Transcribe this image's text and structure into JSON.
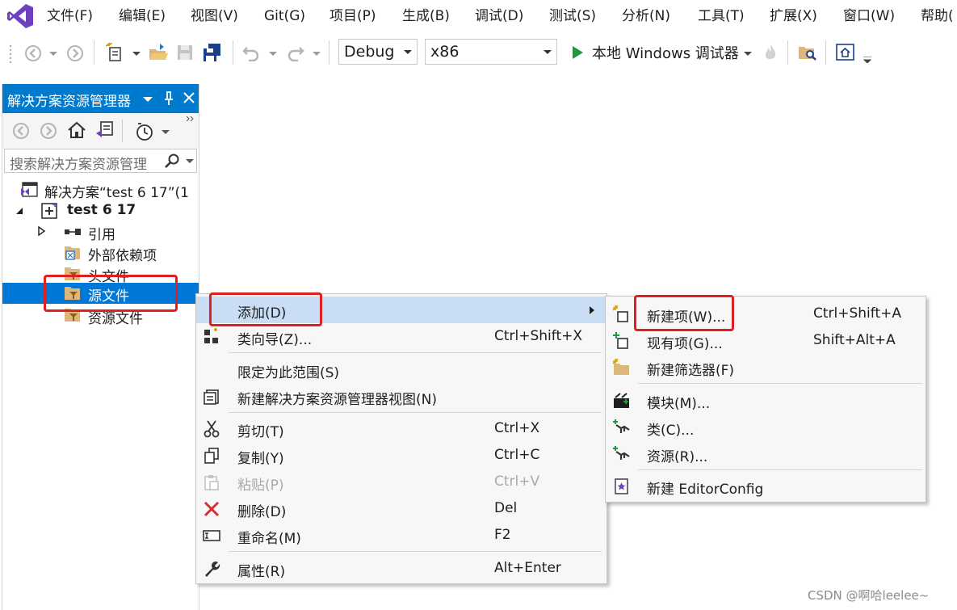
{
  "menubar": {
    "items": [
      "文件(F)",
      "编辑(E)",
      "视图(V)",
      "Git(G)",
      "项目(P)",
      "生成(B)",
      "调试(D)",
      "测试(S)",
      "分析(N)",
      "工具(T)",
      "扩展(X)",
      "窗口(W)",
      "帮助("
    ]
  },
  "toolbar": {
    "config": "Debug",
    "platform": "x86",
    "debugger": "本地 Windows 调试器"
  },
  "solution_explorer": {
    "title": "解决方案资源管理器",
    "search_placeholder": "搜索解决方案资源管理",
    "tree": {
      "solution": "解决方案“test 6 17”(1",
      "project": "test 6 17",
      "references": "引用",
      "external_deps": "外部依赖项",
      "headers": "头文件",
      "sources": "源文件",
      "resources": "资源文件"
    }
  },
  "context_menu": {
    "add": "添加(D)",
    "class_wizard": "类向导(Z)...",
    "class_wizard_shortcut": "Ctrl+Shift+X",
    "scope": "限定为此范围(S)",
    "new_view": "新建解决方案资源管理器视图(N)",
    "cut": "剪切(T)",
    "cut_shortcut": "Ctrl+X",
    "copy": "复制(Y)",
    "copy_shortcut": "Ctrl+C",
    "paste": "粘贴(P)",
    "paste_shortcut": "Ctrl+V",
    "delete": "删除(D)",
    "delete_shortcut": "Del",
    "rename": "重命名(M)",
    "rename_shortcut": "F2",
    "properties": "属性(R)",
    "properties_shortcut": "Alt+Enter"
  },
  "submenu": {
    "new_item": "新建项(W)...",
    "new_item_shortcut": "Ctrl+Shift+A",
    "existing_item": "现有项(G)...",
    "existing_item_shortcut": "Shift+Alt+A",
    "new_filter": "新建筛选器(F)",
    "module": "模块(M)...",
    "class": "类(C)...",
    "resource": "资源(R)...",
    "editorconfig": "新建 EditorConfig"
  },
  "watermark": "CSDN @啊哈leelee~",
  "colors": {
    "accent": "#007acc",
    "selection": "#0078d7",
    "menu_hover": "#c9def5",
    "highlight_box": "#e02020",
    "vs_purple": "#6e3fbf"
  }
}
